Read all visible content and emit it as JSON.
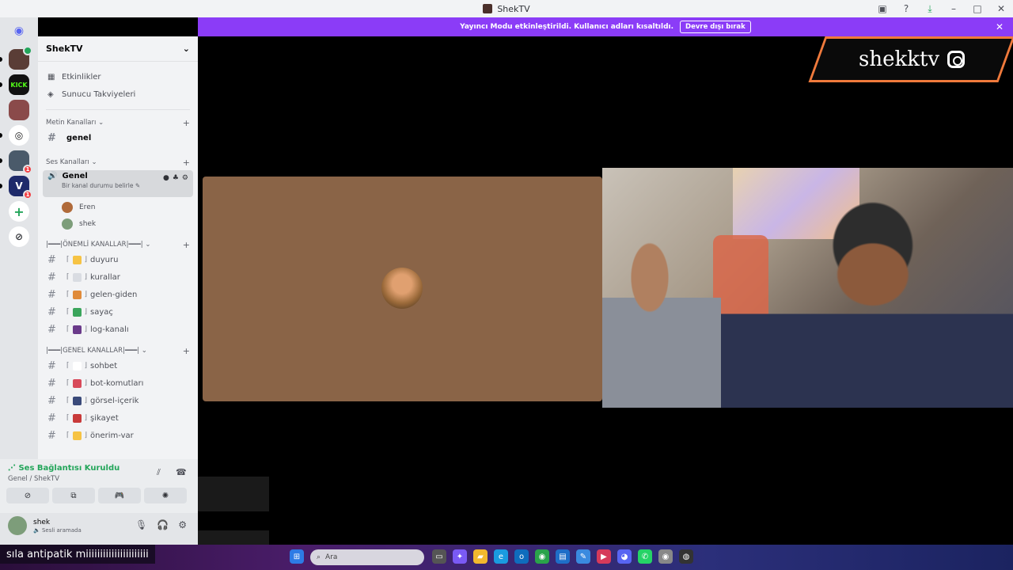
{
  "window": {
    "title": "ShekTV"
  },
  "banner": {
    "message": "Yayıncı Modu etkinleştirildi. Kullanıcı adları kısaltıldı.",
    "button": "Devre dışı bırak"
  },
  "server": {
    "name": "ShekTV",
    "nav": [
      {
        "label": "Etkinlikler",
        "icon": "calendar-icon"
      },
      {
        "label": "Sunucu Takviyeleri",
        "icon": "boost-icon"
      }
    ]
  },
  "categories": {
    "text": "Metin Kanalları",
    "voice": "Ses Kanalları",
    "important": "|━━━|ÖNEMLİ KANALLAR|━━━|",
    "general": "|━━━|GENEL KANALLAR|━━━|"
  },
  "channels": {
    "text": [
      "genel"
    ],
    "voice": {
      "name": "Genel",
      "status": "Bir kanal durumu belirle",
      "members": [
        "Eren",
        "shek"
      ]
    },
    "important": [
      {
        "name": "duyuru",
        "color": "#f6c344"
      },
      {
        "name": "kurallar",
        "color": "#d9dce2"
      },
      {
        "name": "gelen-giden",
        "color": "#e08b3a"
      },
      {
        "name": "sayaç",
        "color": "#3ba55c"
      },
      {
        "name": "log-kanalı",
        "color": "#6a3a8a"
      }
    ],
    "general": [
      {
        "name": "sohbet",
        "color": "#ffffff"
      },
      {
        "name": "bot-komutları",
        "color": "#d84a5a"
      },
      {
        "name": "görsel-içerik",
        "color": "#3a4a7a"
      },
      {
        "name": "şikayet",
        "color": "#c83a3a"
      },
      {
        "name": "önerim-var",
        "color": "#f6c344"
      }
    ]
  },
  "voice_panel": {
    "connection": "Ses Bağlantısı Kuruldu",
    "location": "Genel / ShekTV"
  },
  "user": {
    "name": "shek",
    "status": "Sesli aramada"
  },
  "stream": {
    "watermark": "shekktv"
  },
  "caption": "sıla antipatik miiiiiiiiiiiiiiiiiiiiii",
  "taskbar": {
    "search_placeholder": "Ara"
  },
  "rail": {
    "badges": [
      "1",
      "1"
    ]
  }
}
